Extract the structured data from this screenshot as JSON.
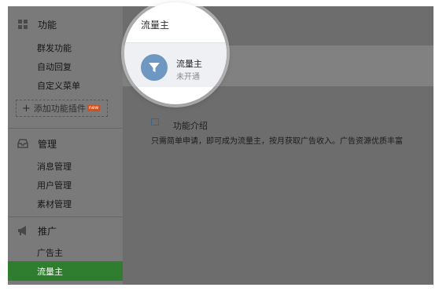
{
  "sidebar": {
    "features": {
      "title": "功能",
      "icon": "grid-icon",
      "items": [
        "群发功能",
        "自动回复",
        "自定义菜单"
      ],
      "add_plugin_label": "添加功能插件",
      "add_plugin_badge": "new"
    },
    "manage": {
      "title": "管理",
      "icon": "inbox-icon",
      "items": [
        "消息管理",
        "用户管理",
        "素材管理"
      ]
    },
    "promote": {
      "title": "推广",
      "icon": "megaphone-icon",
      "items": [
        "广告主",
        "流量主"
      ],
      "active_item": "流量主"
    }
  },
  "main": {
    "page_title": "流量主",
    "account": {
      "name": "流量主",
      "status": "未开通",
      "icon": "funnel-icon"
    },
    "intro": {
      "title": "功能介绍",
      "description": "只需简单申请，即可成为流量主，按月获取广告收入。广告资源优质丰富"
    }
  },
  "colors": {
    "active_green": "#2f7e2f",
    "avatar_blue": "#6e98c2",
    "badge_orange": "#d2501e"
  }
}
